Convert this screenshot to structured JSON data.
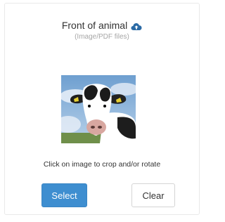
{
  "upload": {
    "title": "Front of animal",
    "title_icon": "cloud-upload-icon",
    "subtitle": "(Image/PDF files)",
    "preview_image": "cow-photo",
    "hint": "Click on image to crop and/or rotate"
  },
  "buttons": {
    "select_label": "Select",
    "clear_label": "Clear"
  },
  "colors": {
    "primary": "#3e8ed0",
    "icon": "#2b6aa5",
    "text": "#333333",
    "muted": "#a6a6a6"
  }
}
